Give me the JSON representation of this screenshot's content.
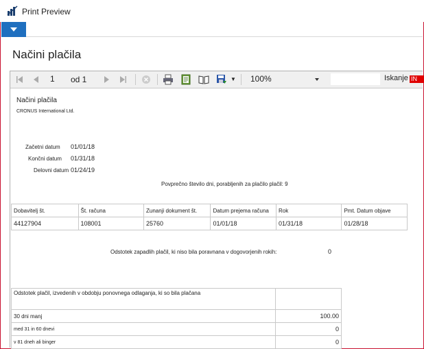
{
  "window": {
    "title": "Print Preview"
  },
  "page": {
    "title": "Načini plačila"
  },
  "toolbar": {
    "page_number": "1",
    "page_of": "od 1",
    "zoom": "100%",
    "search_label": "Iskanje",
    "search_value": "IN"
  },
  "report": {
    "title": "Načini plačila",
    "company": "CRONUS International Ltd.",
    "start_label": "Začetni datum",
    "start_value": "01/01/18",
    "end_label": "Končni datum",
    "end_value": "01/31/18",
    "work_label": "Delovni datum",
    "work_value": "01/24/19",
    "avg_days_text": "Povprečno število dni, porabljenih za plačilo plačil: 9",
    "headers": [
      "Dobavitelj št.",
      "Št. računa",
      "Zunanji dokument št.",
      "Datum prejema računa",
      "Rok",
      "Pmt. Datum objave"
    ],
    "row": [
      "44127904",
      "108001",
      "25760",
      "01/01/18",
      "01/31/18",
      "01/28/18"
    ],
    "late_text": "Odstotek zapadlih plačil, ki niso bila poravnana v dogovorjenih rokih:",
    "late_value": "0",
    "deferred_header": "Odstotek plačil, izvedenih v obdobju ponovnega odlaganja, ki so bila plačana",
    "deferred_rows": [
      {
        "label": "30 dni manj",
        "value": "100.00"
      },
      {
        "label": "med 31 in 60 dnevi",
        "value": "0"
      },
      {
        "label": "v 81 dneh ali binger",
        "value": "0"
      }
    ]
  }
}
